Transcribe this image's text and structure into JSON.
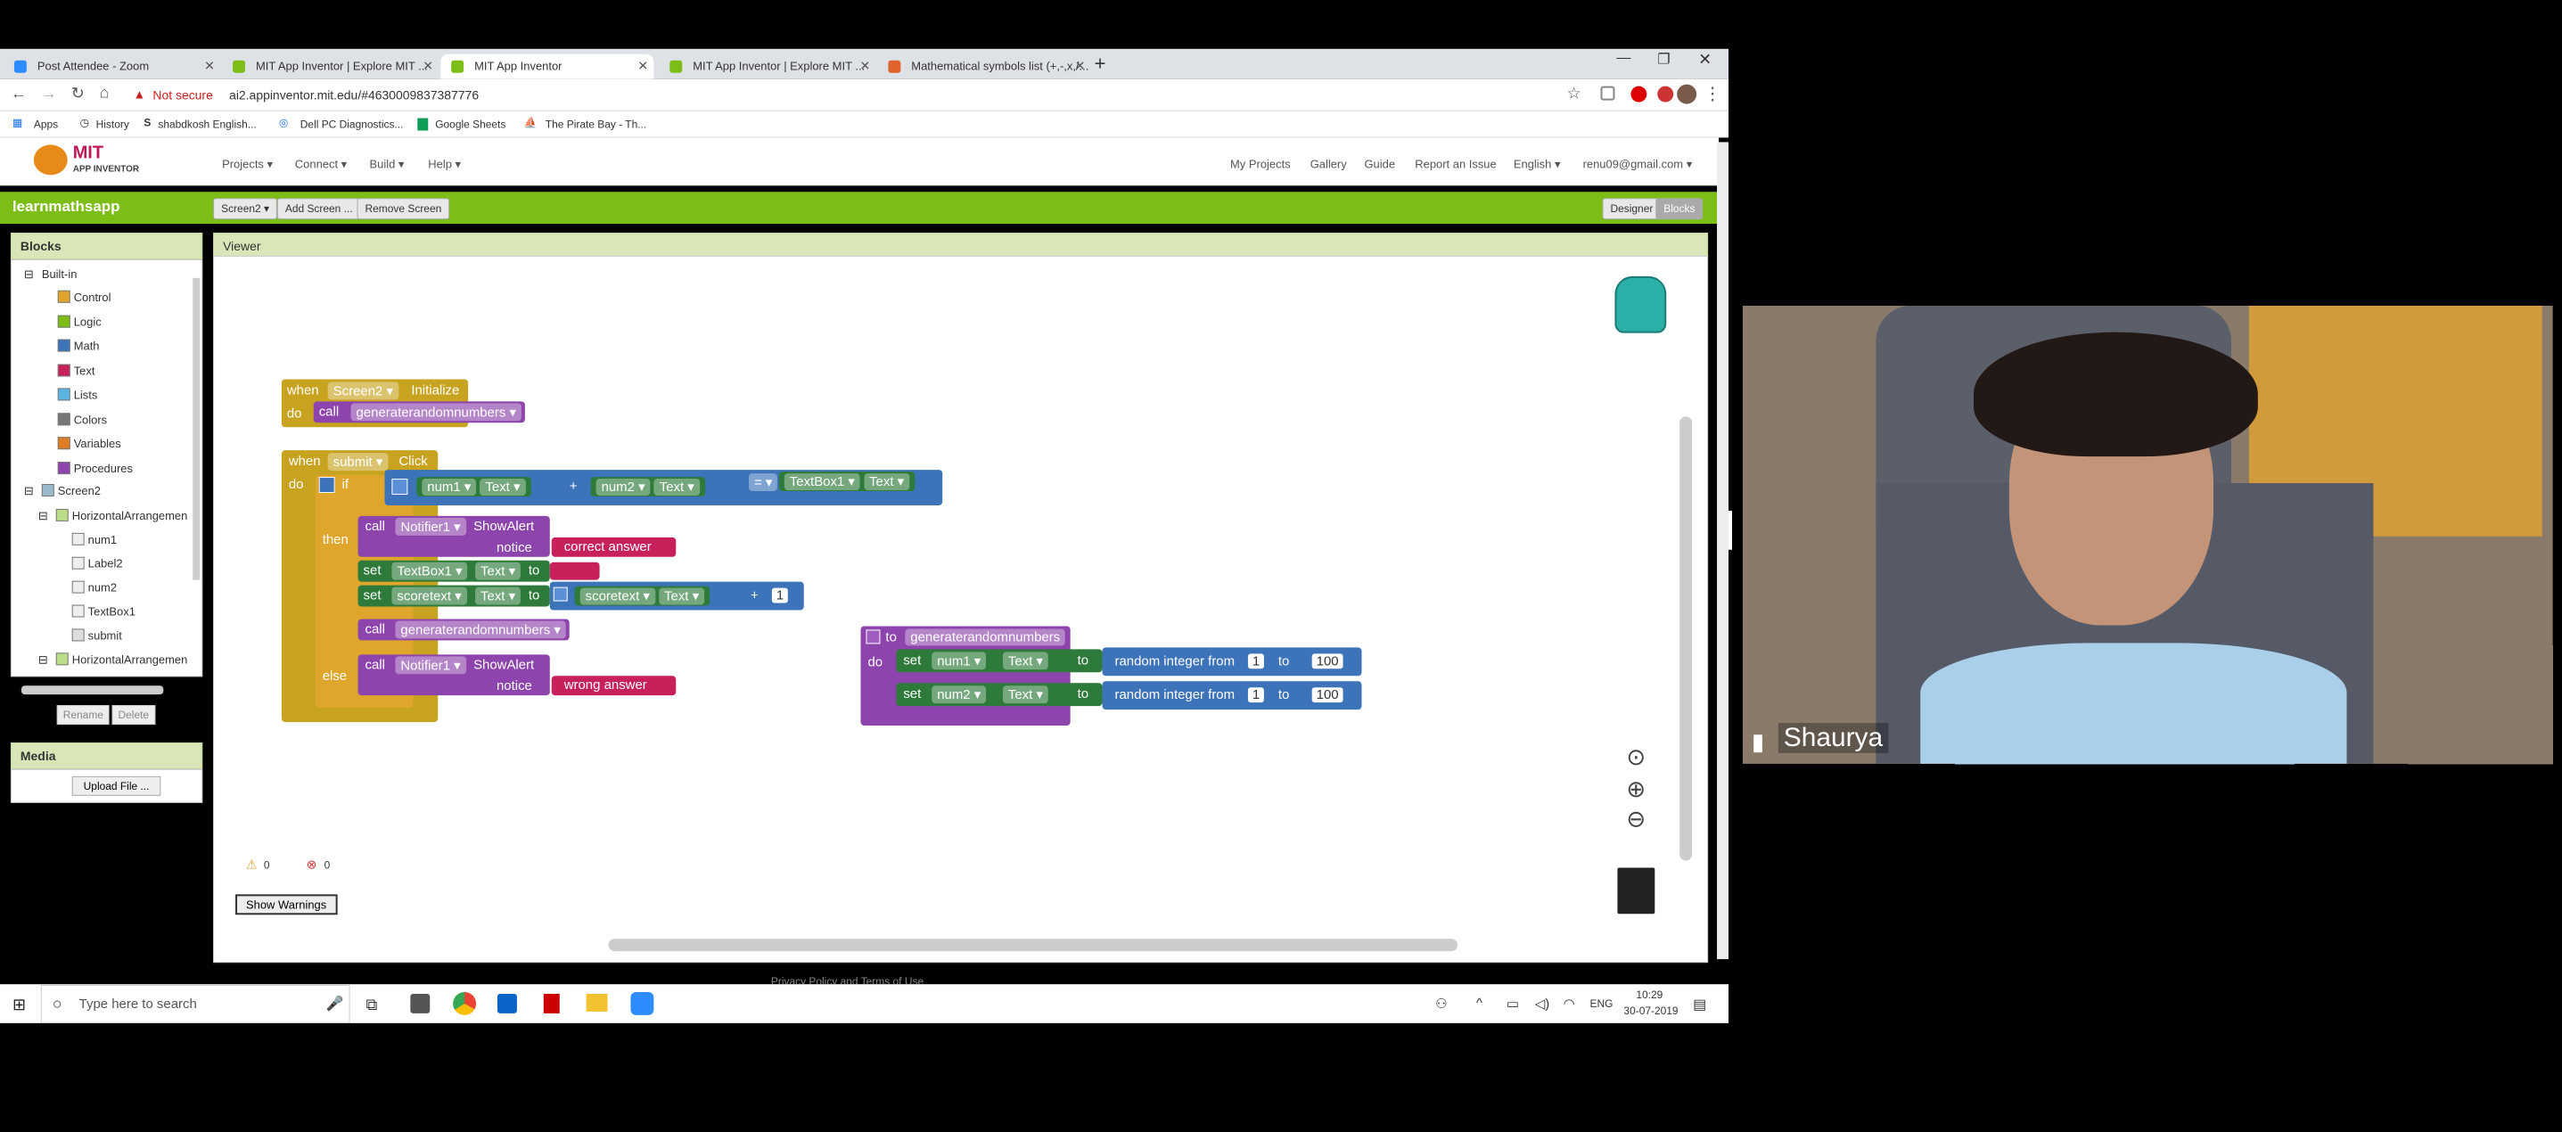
{
  "browser": {
    "tabs": [
      "Post Attendee - Zoom",
      "MIT App Inventor | Explore MIT ...",
      "MIT App Inventor",
      "MIT App Inventor | Explore MIT ...",
      "Mathematical symbols list (+,-,x,/..."
    ],
    "not_secure": "Not secure",
    "url": "ai2.appinventor.mit.edu/#4630009837387776",
    "bookmarks": [
      "Apps",
      "History",
      "shabdkosh English...",
      "Dell PC Diagnostics...",
      "Google Sheets",
      "The Pirate Bay - Th..."
    ]
  },
  "header": {
    "logo_line1": "MIT",
    "logo_line2": "APP INVENTOR",
    "menu": [
      "Projects ▾",
      "Connect ▾",
      "Build ▾",
      "Help ▾"
    ],
    "right": [
      "My Projects",
      "Gallery",
      "Guide",
      "Report an Issue",
      "English ▾",
      "renu09@gmail.com ▾"
    ]
  },
  "toolbar": {
    "project": "learnmathsapp",
    "screen": "Screen2 ▾",
    "add": "Add Screen ...",
    "remove": "Remove Screen",
    "designer": "Designer",
    "blocks": "Blocks"
  },
  "blocks_panel": {
    "title": "Blocks",
    "builtin": "Built-in",
    "builtin_items": [
      {
        "label": "Control",
        "color": "#e0a62c"
      },
      {
        "label": "Logic",
        "color": "#7cbd16"
      },
      {
        "label": "Math",
        "color": "#3d73b8"
      },
      {
        "label": "Text",
        "color": "#c8205a"
      },
      {
        "label": "Lists",
        "color": "#5ab3e0"
      },
      {
        "label": "Colors",
        "color": "#777777"
      },
      {
        "label": "Variables",
        "color": "#e07d22"
      },
      {
        "label": "Procedures",
        "color": "#8e44ad"
      }
    ],
    "screen": "Screen2",
    "arrangement": "HorizontalArrangemen",
    "components": [
      "num1",
      "Label2",
      "num2",
      "TextBox1",
      "submit"
    ],
    "arrangement2": "HorizontalArrangemen",
    "rename": "Rename",
    "delete": "Delete"
  },
  "media": {
    "title": "Media",
    "upload": "Upload File ..."
  },
  "viewer": {
    "title": "Viewer",
    "warn_count": "0",
    "err_count": "0",
    "show_warnings": "Show Warnings"
  },
  "code": {
    "init": {
      "when": "when",
      "comp": "Screen2 ▾",
      "event": "Initialize",
      "do": "do",
      "call": "call",
      "proc": "generaterandomnumbers ▾"
    },
    "click": {
      "when": "when",
      "comp": "submit ▾",
      "event": "Click",
      "do": "do",
      "if": "if",
      "then": "then",
      "else": "else",
      "n1": "num1 ▾",
      "t": "Text ▾",
      "plus": "+",
      "n2": "num2 ▾",
      "eq": "= ▾",
      "tb": "TextBox1 ▾",
      "call": "call",
      "notifier": "Notifier1 ▾",
      "show": "ShowAlert",
      "notice": "notice",
      "correct": "correct answer",
      "wrong": "wrong answer",
      "set": "set",
      "to": "to",
      "score": "scoretext ▾",
      "one": "1",
      "proc": "generaterandomnumbers ▾"
    },
    "proc": {
      "to": "to",
      "name": "generaterandomnumbers",
      "do": "do",
      "set": "set",
      "n1": "num1 ▾",
      "n2": "num2 ▾",
      "t": "Text ▾",
      "to2": "to",
      "rand": "random integer from",
      "from": "1",
      "to3": "to",
      "max": "100"
    }
  },
  "footer": "Privacy Policy and Terms of Use",
  "taskbar": {
    "search": "Type here to search",
    "lang": "ENG",
    "time": "10:29",
    "date": "30-07-2019"
  },
  "video": {
    "name": "Shaurya"
  }
}
